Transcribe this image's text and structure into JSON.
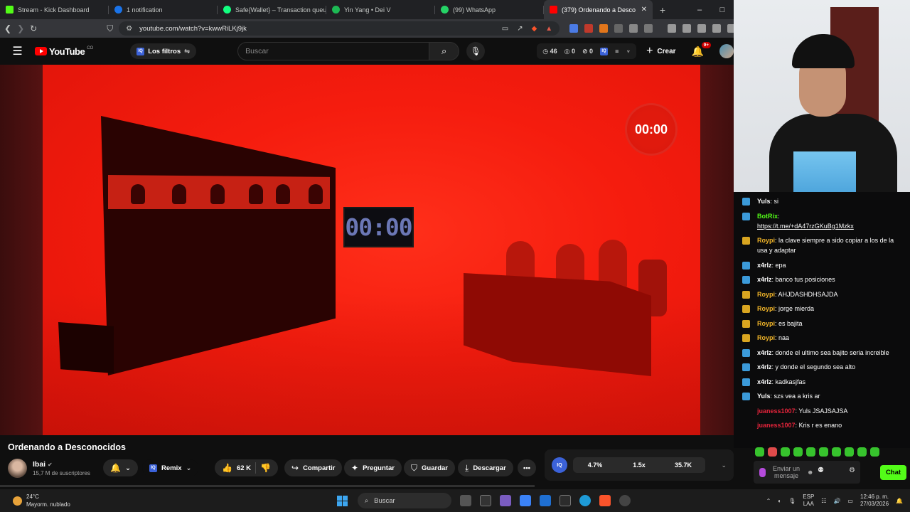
{
  "browser": {
    "tabs": [
      {
        "label": "Stream - Kick Dashboard",
        "icon": "kick-icon",
        "color": "#53fc18"
      },
      {
        "label": "1 notification",
        "icon": "notification-icon",
        "color": "#1a73e8"
      },
      {
        "label": "Safe{Wallet} – Transaction queue",
        "icon": "safe-wallet-icon",
        "color": "#12ff80"
      },
      {
        "label": "Yin Yang • Dei V",
        "icon": "spotify-icon",
        "color": "#1db954"
      },
      {
        "label": "(99) WhatsApp",
        "icon": "whatsapp-icon",
        "color": "#25d366"
      },
      {
        "label": "(379) Ordenando a Desco",
        "icon": "youtube-icon",
        "color": "#ff0000"
      }
    ],
    "new_tab": "+",
    "window_controls": [
      "–",
      "□",
      "✕"
    ],
    "url": "youtube.com/watch?v=kwwRiLKj9jk"
  },
  "youtube": {
    "logo": "YouTube",
    "country": "CO",
    "filters_label": "Los filtros",
    "search_placeholder": "Buscar",
    "stats": {
      "views_seen": "46",
      "hidden": "0",
      "blocked": "0"
    },
    "create_label": "Crear",
    "notif_badge": "9+"
  },
  "video": {
    "tv_timer": "00:00",
    "corner_timer": "00:00",
    "title": "Ordenando a Desconocidos",
    "channel": "Ibai",
    "subscribers": "15,7 M de suscriptores",
    "remix_label": "Remix",
    "likes": "62 K",
    "share_label": "Compartir",
    "ask_label": "Preguntar",
    "save_label": "Guardar",
    "download_label": "Descargar",
    "iq_stats": [
      "4.7%",
      "1.5x",
      "35.7K"
    ]
  },
  "chat": {
    "messages": [
      {
        "user": "Yuls",
        "text": "si",
        "color": "#ffffff"
      },
      {
        "user": "BotRix",
        "text": "",
        "link": "https://t.me/+dA47rzGKuBg1Mzkx",
        "color": "#53fc18"
      },
      {
        "user": "Roypi",
        "text": "la clave siempre a sido copiar a los de la usa y adaptar",
        "color": "#f0b429"
      },
      {
        "user": "x4rlz",
        "text": "epa",
        "color": "#ffffff"
      },
      {
        "user": "x4rlz",
        "text": "banco tus posiciones",
        "color": "#ffffff"
      },
      {
        "user": "Roypi",
        "text": "AHJDASHDHSAJDA",
        "color": "#f0b429"
      },
      {
        "user": "Roypi",
        "text": "jorge mierda",
        "color": "#f0b429"
      },
      {
        "user": "Roypi",
        "text": "es bajita",
        "color": "#f0b429"
      },
      {
        "user": "Roypi",
        "text": "naa",
        "color": "#f0b429"
      },
      {
        "user": "x4rlz",
        "text": "donde el ultimo sea bajito seria increible",
        "color": "#ffffff"
      },
      {
        "user": "x4rlz",
        "text": "y donde el segundo sea alto",
        "color": "#ffffff"
      },
      {
        "user": "x4rlz",
        "text": "kadkasjfas",
        "color": "#ffffff"
      },
      {
        "user": "Yuls",
        "text": "szs vea a kris ar",
        "color": "#ffffff"
      },
      {
        "user": "juaness1007",
        "text": "Yuls JSAJSAJSA",
        "color": "#e5243b"
      },
      {
        "user": "juaness1007",
        "text": "Kris r es enano",
        "color": "#e5243b"
      }
    ],
    "input_placeholder": "Enviar un mensaje",
    "send_label": "Chat"
  },
  "taskbar": {
    "temperature": "24°C",
    "weather": "Mayorm. nublado",
    "search_label": "Buscar",
    "lang_top": "ESP",
    "lang_bottom": "LAA",
    "time": "12:46 p. m.",
    "date": "27/03/2026"
  }
}
